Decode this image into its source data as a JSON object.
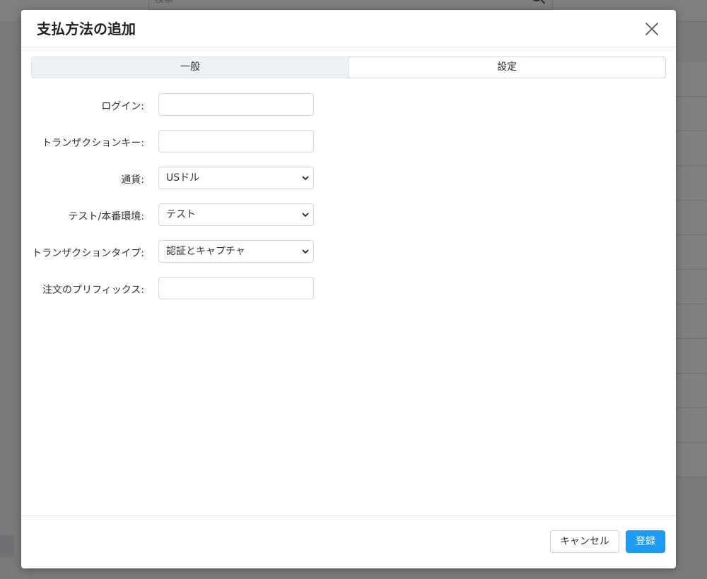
{
  "background": {
    "search_placeholder": "検索"
  },
  "modal": {
    "title": "支払方法の追加",
    "tabs": [
      {
        "label": "一般",
        "active": false
      },
      {
        "label": "設定",
        "active": true
      }
    ],
    "fields": {
      "login": {
        "label": "ログイン:",
        "value": ""
      },
      "transaction_key": {
        "label": "トランザクションキー:",
        "value": ""
      },
      "currency": {
        "label": "通貨:",
        "selected": "USドル"
      },
      "environment": {
        "label": "テスト/本番環境:",
        "selected": "テスト"
      },
      "transaction_type": {
        "label": "トランザクションタイプ:",
        "selected": "認証とキャプチャ"
      },
      "order_prefix": {
        "label": "注文のプリフィックス:",
        "value": ""
      }
    },
    "buttons": {
      "cancel": "キャンセル",
      "submit": "登録"
    }
  },
  "colors": {
    "primary": "#1e9bf5",
    "overlay": "rgba(0,0,0,0.5)"
  }
}
